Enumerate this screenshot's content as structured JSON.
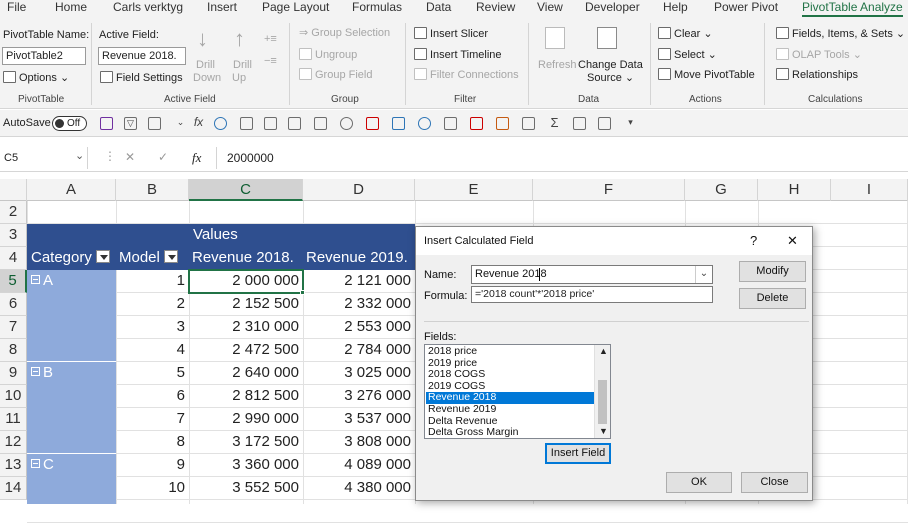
{
  "tabs": [
    "File",
    "Home",
    "Carls verktyg",
    "Insert",
    "Page Layout",
    "Formulas",
    "Data",
    "Review",
    "View",
    "Developer",
    "Help",
    "Power Pivot",
    "PivotTable Analyze"
  ],
  "ribbon": {
    "pivottable": {
      "name_label": "PivotTable Name:",
      "name_value": "PivotTable2",
      "options": "Options",
      "group": "PivotTable"
    },
    "active_field": {
      "label": "Active Field:",
      "value": "Revenue 2018.",
      "settings": "Field Settings",
      "drill_down": [
        "Drill",
        "Down"
      ],
      "drill_up": [
        "Drill",
        "Up"
      ],
      "group": "Active Field"
    },
    "group": {
      "selection": "Group Selection",
      "ungroup": "Ungroup",
      "field": "Group Field",
      "group": "Group"
    },
    "filter": {
      "slicer": "Insert Slicer",
      "timeline": "Insert Timeline",
      "connections": "Filter Connections",
      "group": "Filter"
    },
    "data": {
      "refresh": "Refresh",
      "change": [
        "Change Data",
        "Source"
      ],
      "group": "Data"
    },
    "actions": {
      "clear": "Clear",
      "select": "Select",
      "move": "Move PivotTable",
      "group": "Actions"
    },
    "calculations": {
      "fields": "Fields, Items, & Sets",
      "olap": "OLAP Tools",
      "relationships": "Relationships",
      "group": "Calculations"
    }
  },
  "toolbar": {
    "autosave": "AutoSave",
    "toggle": "Off"
  },
  "formula_bar": {
    "namebox": "C5",
    "fx": "fx",
    "value": "2000000"
  },
  "columns": [
    "A",
    "B",
    "C",
    "D",
    "E",
    "F",
    "G",
    "H",
    "I"
  ],
  "rows": [
    "2",
    "3",
    "4",
    "5",
    "6",
    "7",
    "8",
    "9",
    "10",
    "11",
    "12",
    "13",
    "14"
  ],
  "pivot": {
    "values_label": "Values",
    "headers": [
      "Category",
      "Model",
      "Revenue 2018.",
      "Revenue 2019."
    ],
    "categories": [
      "A",
      "B",
      "C"
    ],
    "models": [
      "1",
      "2",
      "3",
      "4",
      "5",
      "6",
      "7",
      "8",
      "9",
      "10"
    ],
    "rev2018": [
      "2 000 000",
      "2 152 500",
      "2 310 000",
      "2 472 500",
      "2 640 000",
      "2 812 500",
      "2 990 000",
      "3 172 500",
      "3 360 000",
      "3 552 500"
    ],
    "rev2019": [
      "2 121 000",
      "2 332 000",
      "2 553 000",
      "2 784 000",
      "3 025 000",
      "3 276 000",
      "3 537 000",
      "3 808 000",
      "4 089 000",
      "4 380 000"
    ]
  },
  "dialog": {
    "title": "Insert Calculated Field",
    "help": "?",
    "close": "✕",
    "name_label": "Name:",
    "name_value": "Revenue 2018",
    "formula_label": "Formula:",
    "formula_value": "='2018 count'*'2018 price'",
    "modify": "Modify",
    "delete": "Delete",
    "fields_label": "Fields:",
    "fields": [
      "2018 price",
      "2019 price",
      "2018 COGS",
      "2019 COGS",
      "Revenue 2018",
      "Revenue 2019",
      "Delta Revenue",
      "Delta Gross Margin"
    ],
    "selected_field": "Revenue 2018",
    "insert_field": "Insert Field",
    "ok": "OK",
    "close_btn": "Close"
  },
  "colors": {
    "accent": "#217346",
    "pivot_header": "#2f4f8f",
    "pivot_category": "#8eaadb",
    "selection": "#0078d7"
  }
}
